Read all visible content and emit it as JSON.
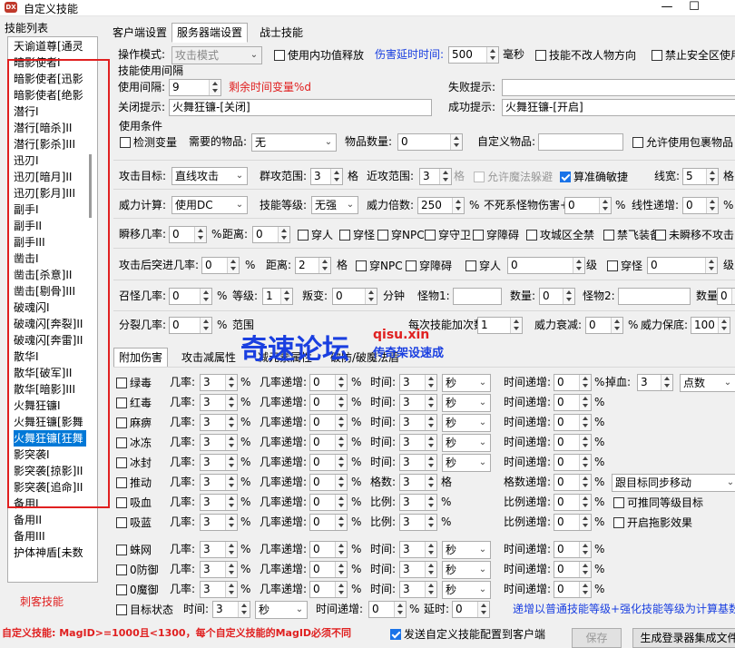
{
  "window": {
    "title": "自定义技能",
    "app_icon": "DX",
    "minimize": "—",
    "maximize": "☐"
  },
  "skill_list": {
    "label": "技能列表",
    "items": [
      "天谕道尊[通灵",
      "暗影使者I",
      "暗影使者[迅影",
      "暗影使者[绝影",
      "潜行I",
      "潜行[暗杀]II",
      "潜行[影杀]III",
      "迅刃I",
      "迅刃[暗月]II",
      "迅刃[影月]III",
      "副手I",
      "副手II",
      "副手III",
      "凿击I",
      "凿击[杀意]II",
      "凿击[剔骨]III",
      "破魂闪I",
      "破魂闪[奔裂]II",
      "破魂闪[奔雷]II",
      "散华I",
      "散华[破军]II",
      "散华[暗影]III",
      "火舞狂镰I",
      "火舞狂镰[影舞",
      "火舞狂镰[狂舞",
      "影突袭I",
      "影突袭[掠影]II",
      "影突袭[追命]II",
      "备用I",
      "备用II",
      "备用III",
      "护体神盾[未数"
    ],
    "selected_index": 24,
    "footer": "刺客技能"
  },
  "tabs": {
    "main": [
      "客户端设置",
      "服务器端设置",
      "战士技能"
    ],
    "active_main": 1,
    "sub": [
      "附加伤害",
      "攻击减属性",
      "减元素属性",
      "破防/破魔法盾"
    ],
    "active_sub": 0
  },
  "form": {
    "op_mode_label": "操作模式:",
    "op_mode_value": "攻击模式",
    "use_mp_chk": "使用内功值释放",
    "delay_label": "伤害延时时间:",
    "delay_value": "500",
    "ms": "毫秒",
    "no_player_dir_chk": "技能不改人物方向",
    "no_safe_chk": "禁止安全区使用",
    "interval_group": "技能使用间隔",
    "use_interval_label": "使用间隔:",
    "use_interval_value": "9",
    "remain_var": "剩余时间变量%d",
    "fail_label": "失败提示:",
    "close_label": "关闭提示:",
    "close_value": "火舞狂镰-[关闭]",
    "success_label": "成功提示:",
    "success_value": "火舞狂镰-[开启]",
    "cond_group": "使用条件",
    "check_var_chk": "检测变量",
    "need_item_label": "需要的物品:",
    "need_item_value": "无",
    "item_qty_label": "物品数量:",
    "item_qty_value": "0",
    "custom_item_label": "自定义物品:",
    "allow_pack_chk": "允许使用包裹物品",
    "target_label": "攻击目标:",
    "target_value": "直线攻击",
    "group_range_label": "群攻范围:",
    "group_range_value": "3",
    "ge": "格",
    "near_range_label": "近攻范围:",
    "near_range_value": "3",
    "allow_dodge_chk": "允许魔法躲避",
    "precise_chk": "算准确敏捷",
    "line_width_label": "线宽:",
    "line_width_value": "5",
    "power_calc_label": "威力计算:",
    "power_calc_value": "使用DC",
    "skill_level_label": "技能等级:",
    "skill_level_value": "无强",
    "power_mult_label": "威力倍数:",
    "power_mult_value": "250",
    "pct": "%",
    "undead_label": "不死系怪物伤害+:",
    "undead_value": "0",
    "linear_label": "线性递增:",
    "linear_value": "0",
    "blink_label": "瞬移几率:",
    "blink_value": "0",
    "dist_label": "距离:",
    "dist_value": "0",
    "cb_row3": [
      "穿人",
      "穿怪",
      "穿NPC",
      "穿守卫",
      "穿障碍",
      "攻城区全禁",
      "禁飞装备",
      "未瞬移不攻击"
    ],
    "retreat_label": "攻击后突进几率:",
    "retreat_value": "0",
    "dist2_value": "2",
    "cb_row4": [
      "穿NPC",
      "穿障碍",
      "穿人",
      "穿怪"
    ],
    "r4_val1": "0",
    "level_label": "级",
    "r4_val2": "0",
    "summon_label": "召怪几率:",
    "summon_value": "0",
    "level2_label": "等级:",
    "level2_value": "1",
    "mutate_label": "叛变:",
    "mutate_value": "0",
    "minute": "分钟",
    "monster1_label": "怪物1:",
    "qty_label": "数量:",
    "qty1_value": "0",
    "monster2_label": "怪物2:",
    "qty2_value": "0",
    "split_label": "分裂几率:",
    "split_value": "0",
    "range_label": "范围",
    "cast_label": "每次技能加次数",
    "cast_value": "1",
    "power_decay_label": "威力衰减:",
    "power_decay_value": "0",
    "power_keep_label": "威力保底:",
    "power_keep_value": "100",
    "rate_label": "几率:",
    "rate_inc_label": "几率递增:",
    "time_label": "时间:",
    "time_inc_label": "时间递增:",
    "sec": "秒",
    "effects": [
      {
        "name": "绿毒",
        "rate": "3",
        "rinc": "0",
        "time": "3",
        "tinc": "0"
      },
      {
        "name": "红毒",
        "rate": "3",
        "rinc": "0",
        "time": "3",
        "tinc": "0"
      },
      {
        "name": "麻痹",
        "rate": "3",
        "rinc": "0",
        "time": "3",
        "tinc": "0"
      },
      {
        "name": "冰冻",
        "rate": "3",
        "rinc": "0",
        "time": "3",
        "tinc": "0"
      },
      {
        "name": "冰封",
        "rate": "3",
        "rinc": "0",
        "time": "3",
        "tinc": "0"
      }
    ],
    "drop_label": "掉血:",
    "drop_value": "3",
    "drop_mode": "点数",
    "push": {
      "name": "推动",
      "rate": "3",
      "rinc": "0",
      "count_label": "格数:",
      "count": "3",
      "unit": "格",
      "cinc_label": "格数递增:",
      "cinc": "0",
      "follow": "跟目标同步移动"
    },
    "suck_hp": {
      "name": "吸血",
      "rate": "3",
      "rinc": "0",
      "ratio_label": "比例:",
      "ratio": "3",
      "rinc_label": "比例递增:",
      "rinc2": "0",
      "extra_chk": "可推同等级目标"
    },
    "suck_mp": {
      "name": "吸蓝",
      "rate": "3",
      "rinc": "0",
      "ratio": "3",
      "rinc2": "0",
      "extra_chk": "开启拖影效果"
    },
    "spider": {
      "name": "蛛网",
      "rate": "3",
      "rinc": "0",
      "time": "3",
      "tinc": "0"
    },
    "zero_def": {
      "name": "0防御",
      "rate": "3",
      "rinc": "0",
      "time": "3",
      "tinc": "0"
    },
    "zero_mdef": {
      "name": "0魔御",
      "rate": "3",
      "rinc": "0",
      "time": "3",
      "tinc": "0"
    },
    "target_state_chk": "目标状态",
    "ts_time": "3",
    "ts_unit": "秒",
    "ts_tinc": "0",
    "ts_delay_label": "延时:",
    "ts_delay": "0",
    "formula_note": "递增以普通技能等级+强化技能等级为计算基数"
  },
  "watermark": {
    "main": "奇速论坛",
    "domain": "qisu.xin",
    "sub": "传奇架设速成"
  },
  "footer": {
    "warning": "自定义技能: MagID>=1000且<1300，每个自定义技能的MagID必须不同",
    "send_chk": "发送自定义技能配置到客户端",
    "save_btn": "保存",
    "gen_btn": "生成登录器集成文件"
  },
  "colors": {
    "red": "#e02020",
    "blue": "#1a3fe0",
    "selection": "#0078d7"
  }
}
